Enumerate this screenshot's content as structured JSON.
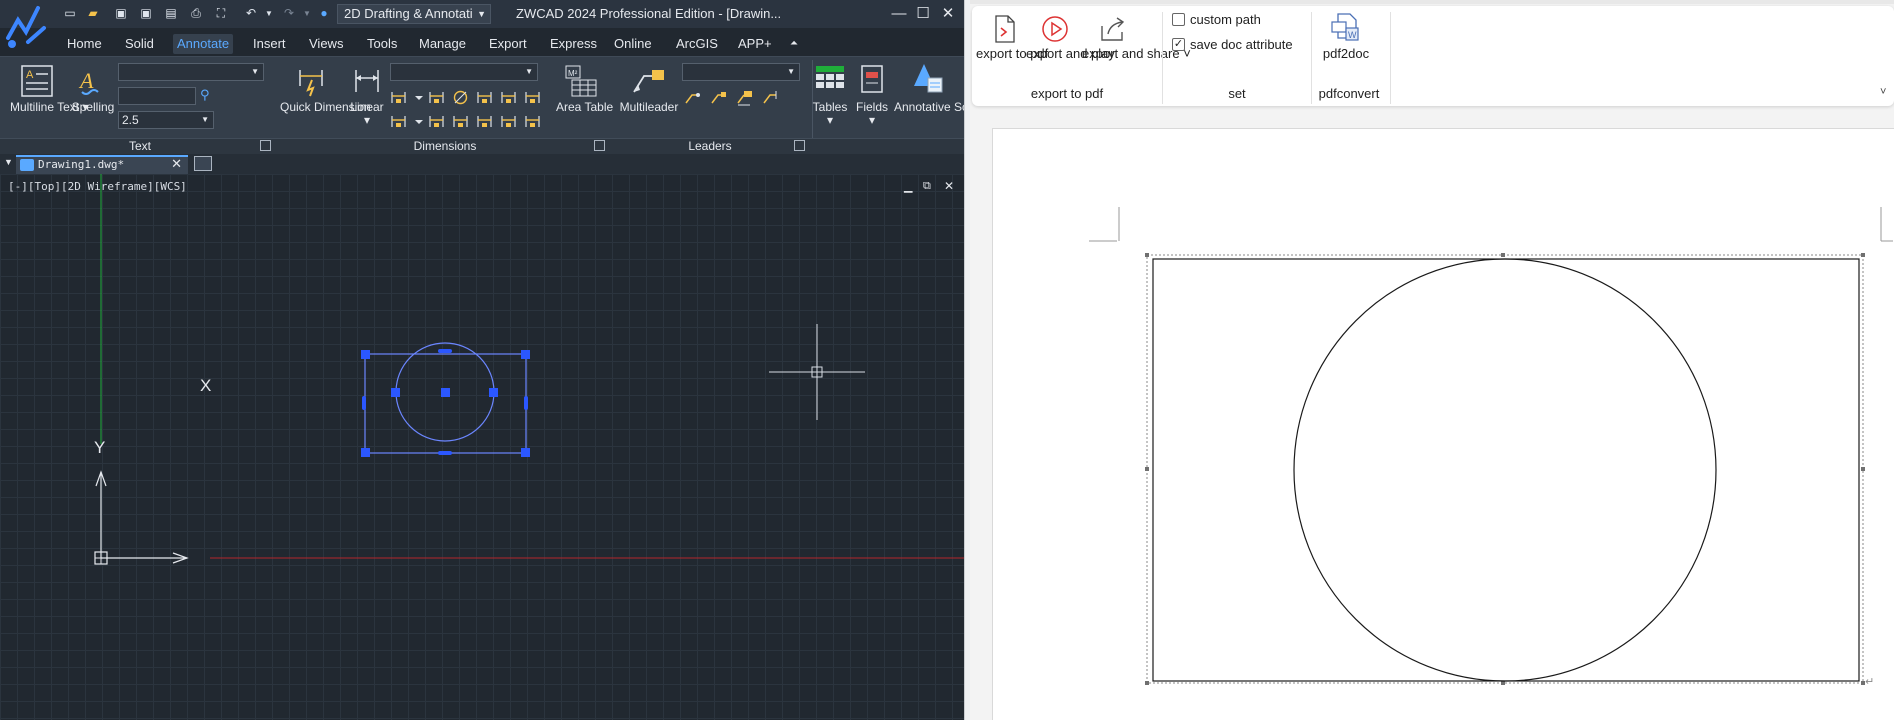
{
  "cad": {
    "title": "ZWCAD 2024 Professional Edition - [Drawin...",
    "workspace": "2D Drafting & Annotati",
    "menu_tabs": [
      "Home",
      "Solid",
      "Annotate",
      "Insert",
      "Views",
      "Tools",
      "Manage",
      "Export",
      "Express",
      "Online",
      "ArcGIS",
      "APP+"
    ],
    "active_tab": "Annotate",
    "ribbon": {
      "text_panel": {
        "title": "Text",
        "multiline_text": "Multiline Text",
        "spelling": "Spelling",
        "text_height": "2.5"
      },
      "dimensions_panel": {
        "title": "Dimensions",
        "quick_dimension": "Quick Dimension",
        "linear": "Linear",
        "area_table": "Area Table"
      },
      "leaders_panel": {
        "title": "Leaders",
        "multileader": "Multileader"
      },
      "tables": "Tables",
      "fields": "Fields",
      "annotative_scale": "Annotative Scale"
    },
    "doc_tab": "Drawing1.dwg*",
    "viewport_label": "[-][Top][2D Wireframe][WCS]",
    "axis_x": "X",
    "axis_y": "Y",
    "colors": {
      "background": "#212830",
      "ribbon": "#343e4a",
      "accent": "#5aa9ff",
      "selection": "#2b57ff",
      "x_axis": "#b3262b",
      "y_axis": "#1fae3a"
    }
  },
  "word": {
    "export_to_pdf": "export to pdf",
    "export_and_play": "export and play",
    "export_and_share": "export and share",
    "custom_path": "custom path",
    "custom_path_checked": false,
    "save_doc_attribute": "save doc attribute",
    "save_doc_attribute_checked": true,
    "pdf2doc": "pdf2doc",
    "groups": {
      "export": "export to pdf",
      "set": "set",
      "pdfconvert": "pdfconvert"
    }
  }
}
